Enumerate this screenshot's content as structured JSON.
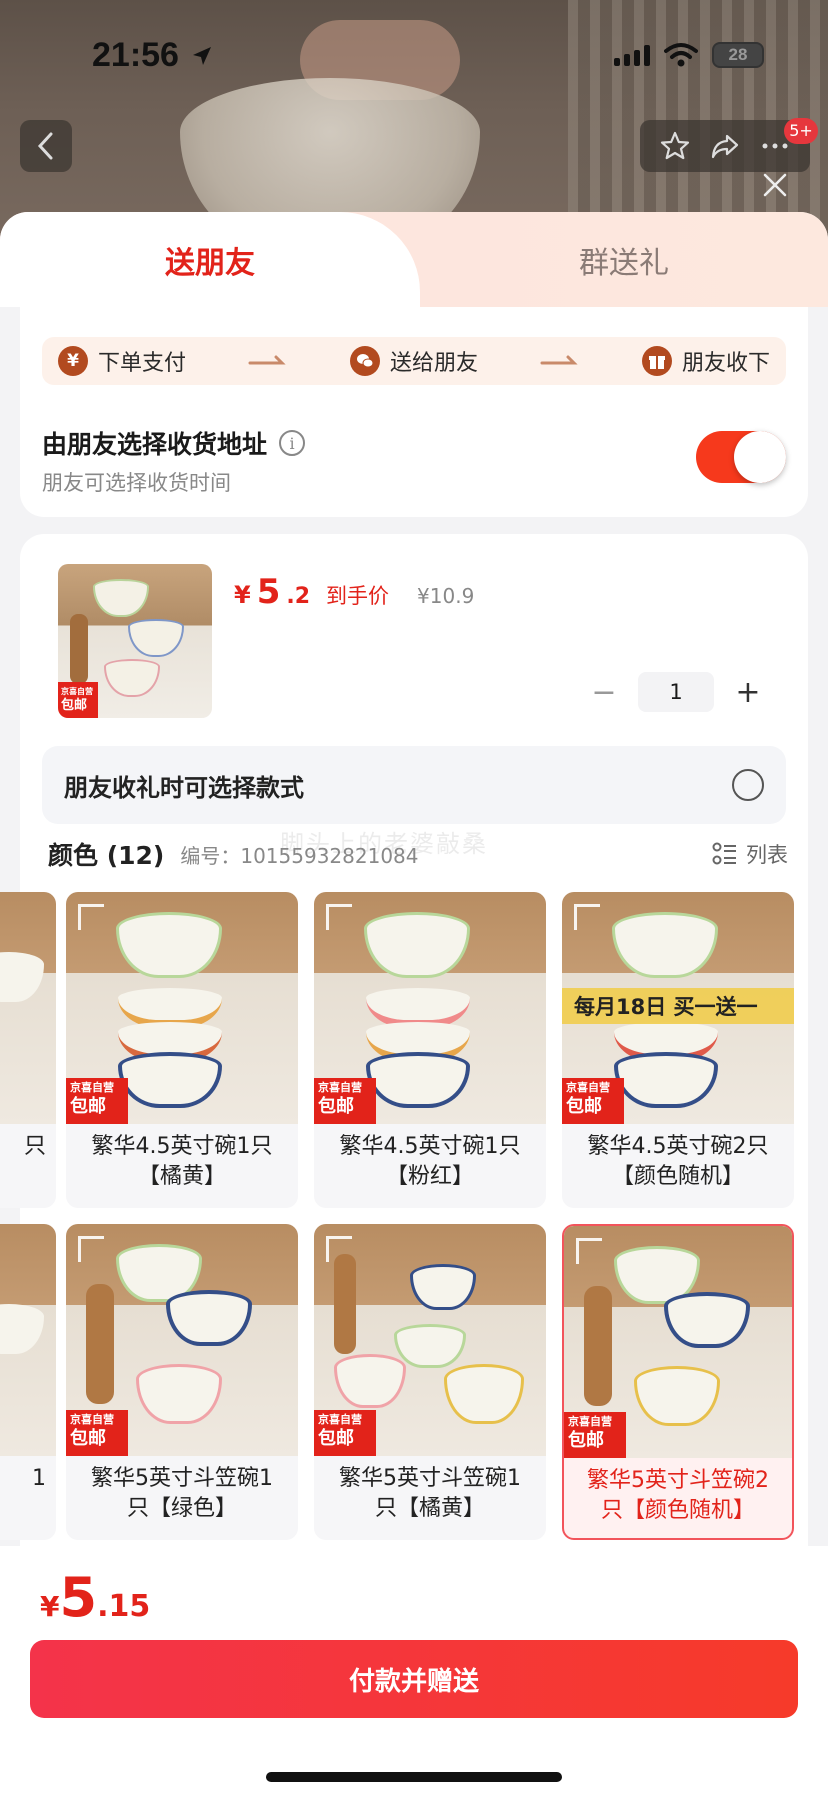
{
  "status_bar": {
    "time": "21:56",
    "battery": "28"
  },
  "nav": {
    "badge": "5+"
  },
  "tabs": [
    {
      "label": "送朋友",
      "active": true
    },
    {
      "label": "群送礼",
      "active": false
    }
  ],
  "steps": [
    {
      "icon": "yen-icon",
      "label": "下单支付"
    },
    {
      "icon": "wechat-icon",
      "label": "送给朋友"
    },
    {
      "icon": "gift-icon",
      "label": "朋友收下"
    }
  ],
  "address": {
    "title": "由朋友选择收货地址",
    "subtitle": "朋友可选择收货时间",
    "toggle_on": true
  },
  "product": {
    "thumb_tag_top": "京喜自营",
    "thumb_tag_bottom": "包邮",
    "price_symbol": "¥",
    "price_int": "5",
    "price_dec": ".2",
    "price_label": "到手价",
    "original_price": "¥10.9",
    "quantity": "1",
    "minus": "−",
    "plus": "+"
  },
  "style_option": {
    "label": "朋友收礼时可选择款式"
  },
  "color_section": {
    "title": "颜色 (12)",
    "sku": "编号：10155932821084",
    "list_label": "列表",
    "watermark": "脚头上的老婆敲桑"
  },
  "variants": [
    {
      "name_line1": "只",
      "name_line2": "",
      "partial": true
    },
    {
      "name_line1": "繁华4.5英寸碗1只",
      "name_line2": "【橘黄】",
      "tag_top": "京喜自营",
      "tag_bottom": "包邮"
    },
    {
      "name_line1": "繁华4.5英寸碗1只",
      "name_line2": "【粉红】",
      "tag_top": "京喜自营",
      "tag_bottom": "包邮"
    },
    {
      "name_line1": "繁华4.5英寸碗2只",
      "name_line2": "【颜色随机】",
      "tag_top": "京喜自营",
      "tag_bottom": "包邮",
      "promo": "每月18日 买一送一"
    },
    {
      "name_line1": "1",
      "name_line2": "",
      "partial": true
    },
    {
      "name_line1": "繁华5英寸斗笠碗1",
      "name_line2": "只【绿色】",
      "tag_top": "京喜自营",
      "tag_bottom": "包邮"
    },
    {
      "name_line1": "繁华5英寸斗笠碗1",
      "name_line2": "只【橘黄】",
      "tag_top": "京喜自营",
      "tag_bottom": "包邮"
    },
    {
      "name_line1": "繁华5英寸斗笠碗2",
      "name_line2": "只【颜色随机】",
      "tag_top": "京喜自营",
      "tag_bottom": "包邮",
      "selected": true
    }
  ],
  "bottom": {
    "total_symbol": "¥",
    "total_int": "5",
    "total_dec": ".15",
    "pay_label": "付款并赠送"
  },
  "colors": {
    "accent_red": "#e2231a",
    "toggle_on": "#f6391c",
    "step_icon": "#b24a1f"
  }
}
